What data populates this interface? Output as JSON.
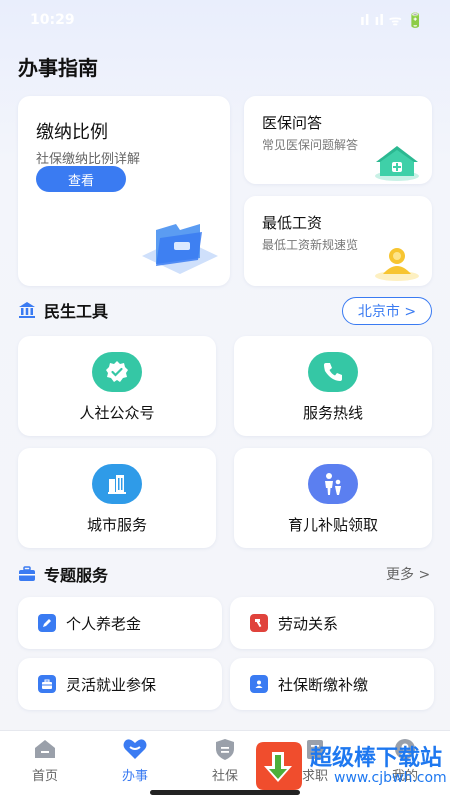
{
  "status_bar": {
    "time": "10:29",
    "signal": "ıl ıl ᯤ 🔋"
  },
  "page": {
    "title": "办事指南"
  },
  "guide_cards": {
    "contribution": {
      "title": "缴纳比例",
      "subtitle": "社保缴纳比例详解",
      "button": "查看"
    },
    "medical": {
      "title": "医保问答",
      "subtitle": "常见医保问题解答"
    },
    "min_wage": {
      "title": "最低工资",
      "subtitle": "最低工资新规速览"
    }
  },
  "tools_section": {
    "title": "民生工具",
    "city": "北京市 >",
    "items": [
      {
        "label": "人社公众号",
        "icon": "check-badge-icon",
        "color": "#35c7a5"
      },
      {
        "label": "服务热线",
        "icon": "phone-icon",
        "color": "#35c7a5"
      },
      {
        "label": "城市服务",
        "icon": "building-icon",
        "color": "#2f9be8"
      },
      {
        "label": "育儿补贴领取",
        "icon": "family-icon",
        "color": "#5b7ff0"
      }
    ]
  },
  "special_section": {
    "title": "专题服务",
    "more": "更多 >",
    "items": [
      {
        "label": "个人养老金",
        "icon": "pen-icon",
        "color": "#3a7bf2"
      },
      {
        "label": "劳动关系",
        "icon": "hammer-icon",
        "color": "#e0433c"
      },
      {
        "label": "灵活就业参保",
        "icon": "briefcase-icon",
        "color": "#3a7bf2"
      },
      {
        "label": "社保断缴补缴",
        "icon": "user-badge-icon",
        "color": "#3a7bf2"
      }
    ]
  },
  "tabbar": {
    "tabs": [
      {
        "label": "首页",
        "icon": "home-icon"
      },
      {
        "label": "办事",
        "icon": "heart-icon"
      },
      {
        "label": "社保",
        "icon": "shield-icon"
      },
      {
        "label": "求职",
        "icon": "document-icon"
      },
      {
        "label": "我的",
        "icon": "person-icon"
      }
    ],
    "active": "办事"
  },
  "watermark": {
    "text": "超级棒下载站",
    "url": "www.cjbwh.com"
  },
  "colors": {
    "accent": "#3a7bf2",
    "teal": "#35c7a5"
  }
}
